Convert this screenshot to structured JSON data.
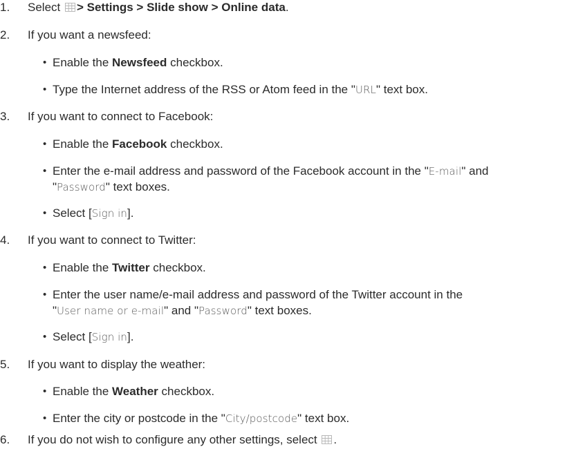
{
  "steps": [
    {
      "number": "1.",
      "parts": {
        "prefix": "Select",
        "path": "> Settings > Slide show > Online data",
        "suffix": "."
      }
    },
    {
      "number": "2.",
      "text": "If you want a newsfeed:",
      "bullets": [
        {
          "pre": "Enable the",
          "bold": "Newsfeed",
          "post": "checkbox."
        },
        {
          "pre": "Type the Internet address of the RSS or Atom feed in the \"",
          "label": "URL",
          "post": "\" text box."
        }
      ]
    },
    {
      "number": "3.",
      "text": "If you want to connect to Facebook:",
      "bullets": [
        {
          "pre": "Enable the",
          "bold": "Facebook",
          "post": "checkbox."
        },
        {
          "line1_pre": "Enter the e-mail address and password of the Facebook account in the \"",
          "line1_label": "E-mail",
          "line1_post": "\" and",
          "line2_pre": "\"",
          "line2_label": "Password",
          "line2_post": "\" text boxes."
        },
        {
          "pre": "Select [",
          "label": "Sign in",
          "post": "]."
        }
      ]
    },
    {
      "number": "4.",
      "text": "If you want to connect to Twitter:",
      "bullets": [
        {
          "pre": "Enable the",
          "bold": "Twitter",
          "post": "checkbox."
        },
        {
          "line1": "Enter the user name/e-mail address and password of the Twitter account in the",
          "line2_pre": "\"",
          "line2_label1": "User name or e-mail",
          "line2_mid": "\" and \"",
          "line2_label2": "Password",
          "line2_post": "\" text boxes."
        },
        {
          "pre": "Select [",
          "label": "Sign in",
          "post": "]."
        }
      ]
    },
    {
      "number": "5.",
      "text": "If you want to display the weather:",
      "bullets": [
        {
          "pre": "Enable the",
          "bold": "Weather",
          "post": "checkbox."
        },
        {
          "pre": "Enter the city or postcode in the \"",
          "label": "City/postcode",
          "post": "\" text box."
        }
      ]
    },
    {
      "number": "6.",
      "text_pre": "If you do not wish to configure any other settings, select",
      "text_post": "."
    }
  ],
  "bullet_char": "•",
  "icons": {
    "menu": "grid-menu-icon",
    "menu_color": "#b8b8b8"
  }
}
